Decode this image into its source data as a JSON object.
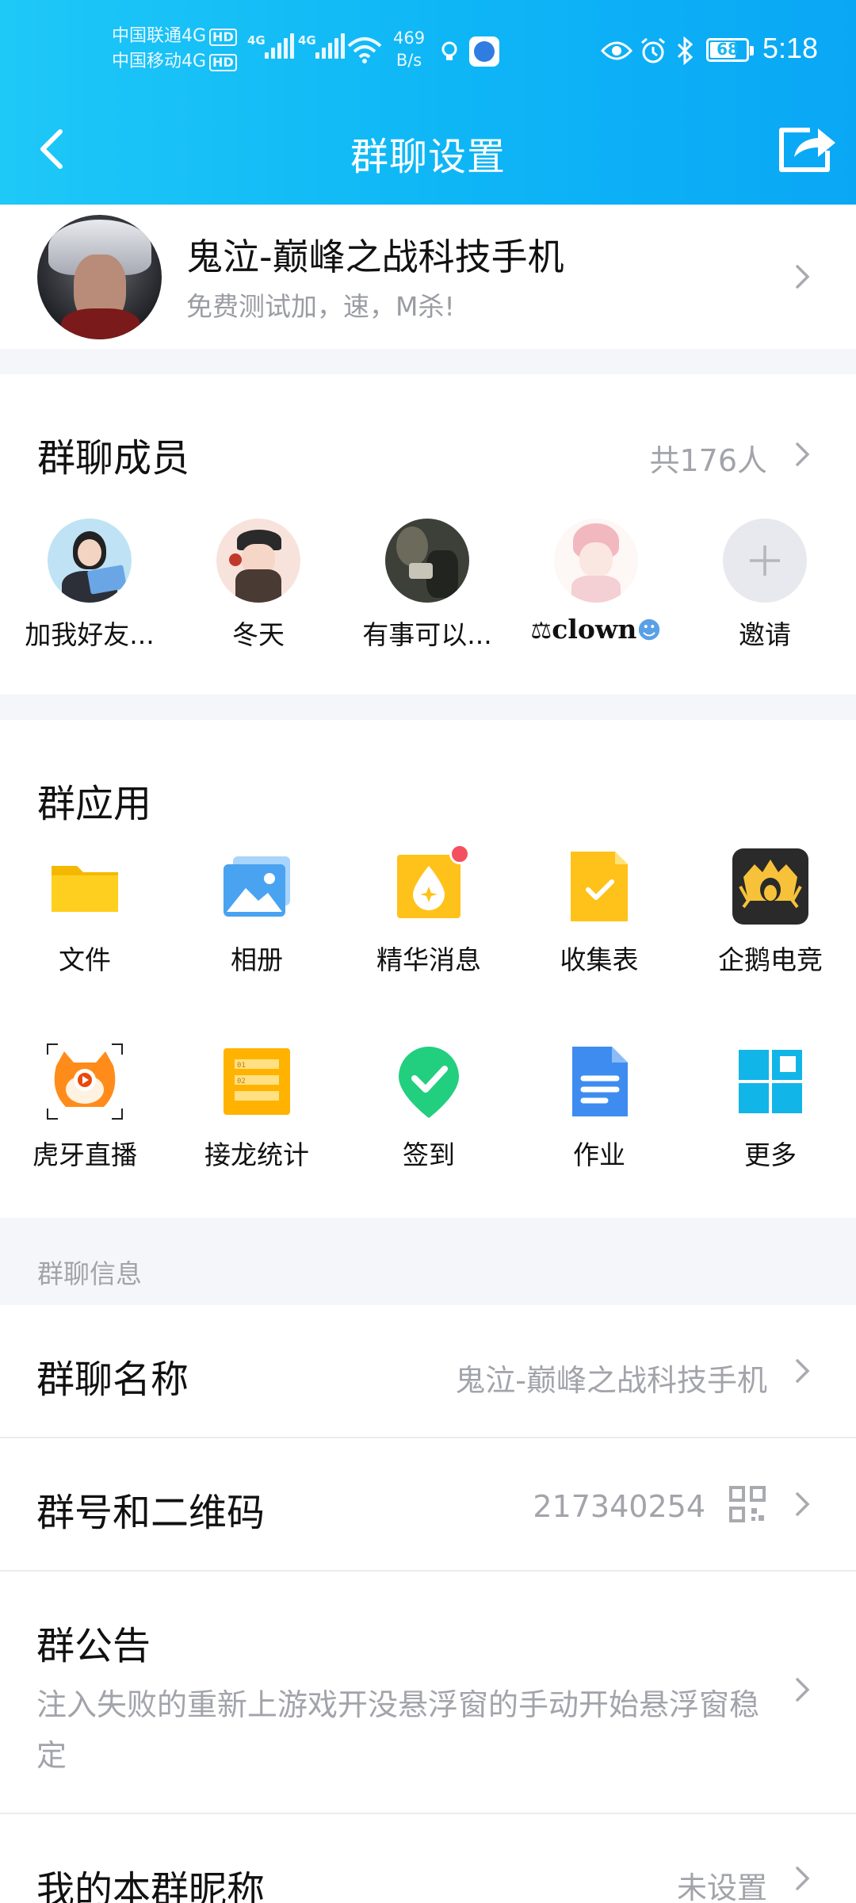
{
  "status_bar": {
    "carrier1": "中国联通4G",
    "carrier2": "中国移动4G",
    "hd": "HD",
    "net_label": "4G",
    "speed_value": "469",
    "speed_unit": "B/s",
    "battery": "68",
    "time": "5:18"
  },
  "nav": {
    "title": "群聊设置"
  },
  "group": {
    "name": "鬼泣-巅峰之战科技手机",
    "description": "免费测试加，速，M杀!"
  },
  "members": {
    "title": "群聊成员",
    "count": "共176人",
    "list": [
      {
        "name": "加我好友..."
      },
      {
        "name": "冬天"
      },
      {
        "name": "有事可以..."
      },
      {
        "name": "clown"
      },
      {
        "name": "邀请"
      }
    ]
  },
  "apps": {
    "title": "群应用",
    "items": [
      {
        "label": "文件",
        "icon": "folder-icon"
      },
      {
        "label": "相册",
        "icon": "photo-album-icon"
      },
      {
        "label": "精华消息",
        "icon": "essence-message-icon"
      },
      {
        "label": "收集表",
        "icon": "collection-form-icon"
      },
      {
        "label": "企鹅电竞",
        "icon": "penguin-esports-icon"
      },
      {
        "label": "虎牙直播",
        "icon": "huya-live-icon"
      },
      {
        "label": "接龙统计",
        "icon": "relay-stats-icon"
      },
      {
        "label": "签到",
        "icon": "check-in-icon"
      },
      {
        "label": "作业",
        "icon": "homework-icon"
      },
      {
        "label": "更多",
        "icon": "more-apps-icon"
      }
    ]
  },
  "info": {
    "header": "群聊信息",
    "name_label": "群聊名称",
    "name_value": "鬼泣-巅峰之战科技手机",
    "number_label": "群号和二维码",
    "number_value": "217340254",
    "notice_label": "群公告",
    "notice_text": "注入失败的重新上游戏开没悬浮窗的手动开始悬浮窗稳定",
    "nickname_label": "我的本群昵称",
    "nickname_value": "未设置"
  },
  "colors": {
    "header_start": "#1ec8f7",
    "header_end": "#0aa7f5",
    "badge_red": "#f5505f"
  }
}
